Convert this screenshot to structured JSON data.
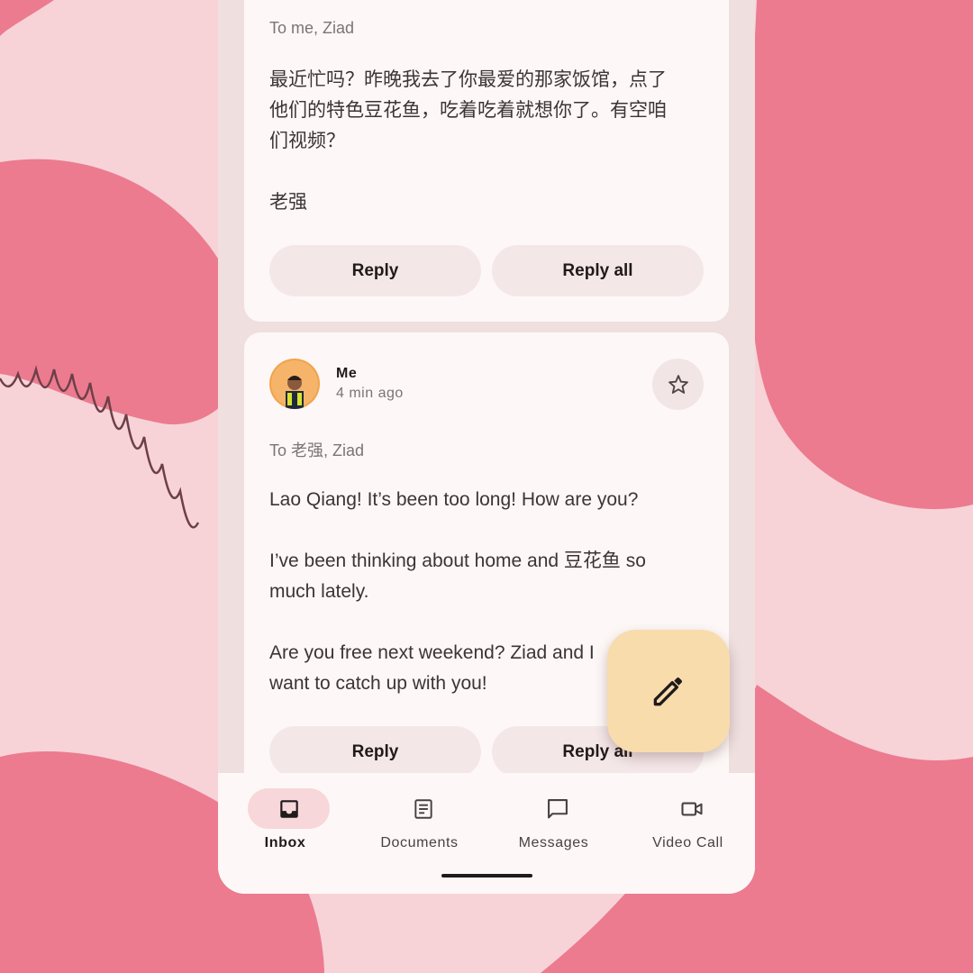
{
  "colors": {
    "background": "#f7d3d8",
    "surface": "#fdf8f7",
    "button": "#f4e7e8",
    "fab": "#f8dcac",
    "nav_active": "#f7d7d9"
  },
  "messages": [
    {
      "recipients": "To me, Ziad",
      "body": "最近忙吗？昨晚我去了你最爱的那家饭馆，点了\n他们的特色豆花鱼，吃着吃着就想你了。有空咱\n们视频？\n\n老强",
      "reply_label": "Reply",
      "reply_all_label": "Reply all"
    },
    {
      "sender": "Me",
      "time": "4 min ago",
      "avatar_icon": "avatar-photo",
      "star_icon": "star-outline-icon",
      "recipients": "To 老强, Ziad",
      "body": "Lao Qiang! It’s been too long! How are you?\n\nI’ve been thinking about home and 豆花鱼 so\nmuch lately.\n\nAre you free next weekend? Ziad and I\nwant to catch up with you!",
      "reply_label": "Reply",
      "reply_all_label": "Reply all"
    }
  ],
  "fab": {
    "icon": "pencil-icon"
  },
  "nav": {
    "items": [
      {
        "label": "Inbox",
        "icon": "inbox-icon",
        "active": true
      },
      {
        "label": "Documents",
        "icon": "document-icon",
        "active": false
      },
      {
        "label": "Messages",
        "icon": "chat-icon",
        "active": false
      },
      {
        "label": "Video Call",
        "icon": "video-icon",
        "active": false
      }
    ]
  }
}
